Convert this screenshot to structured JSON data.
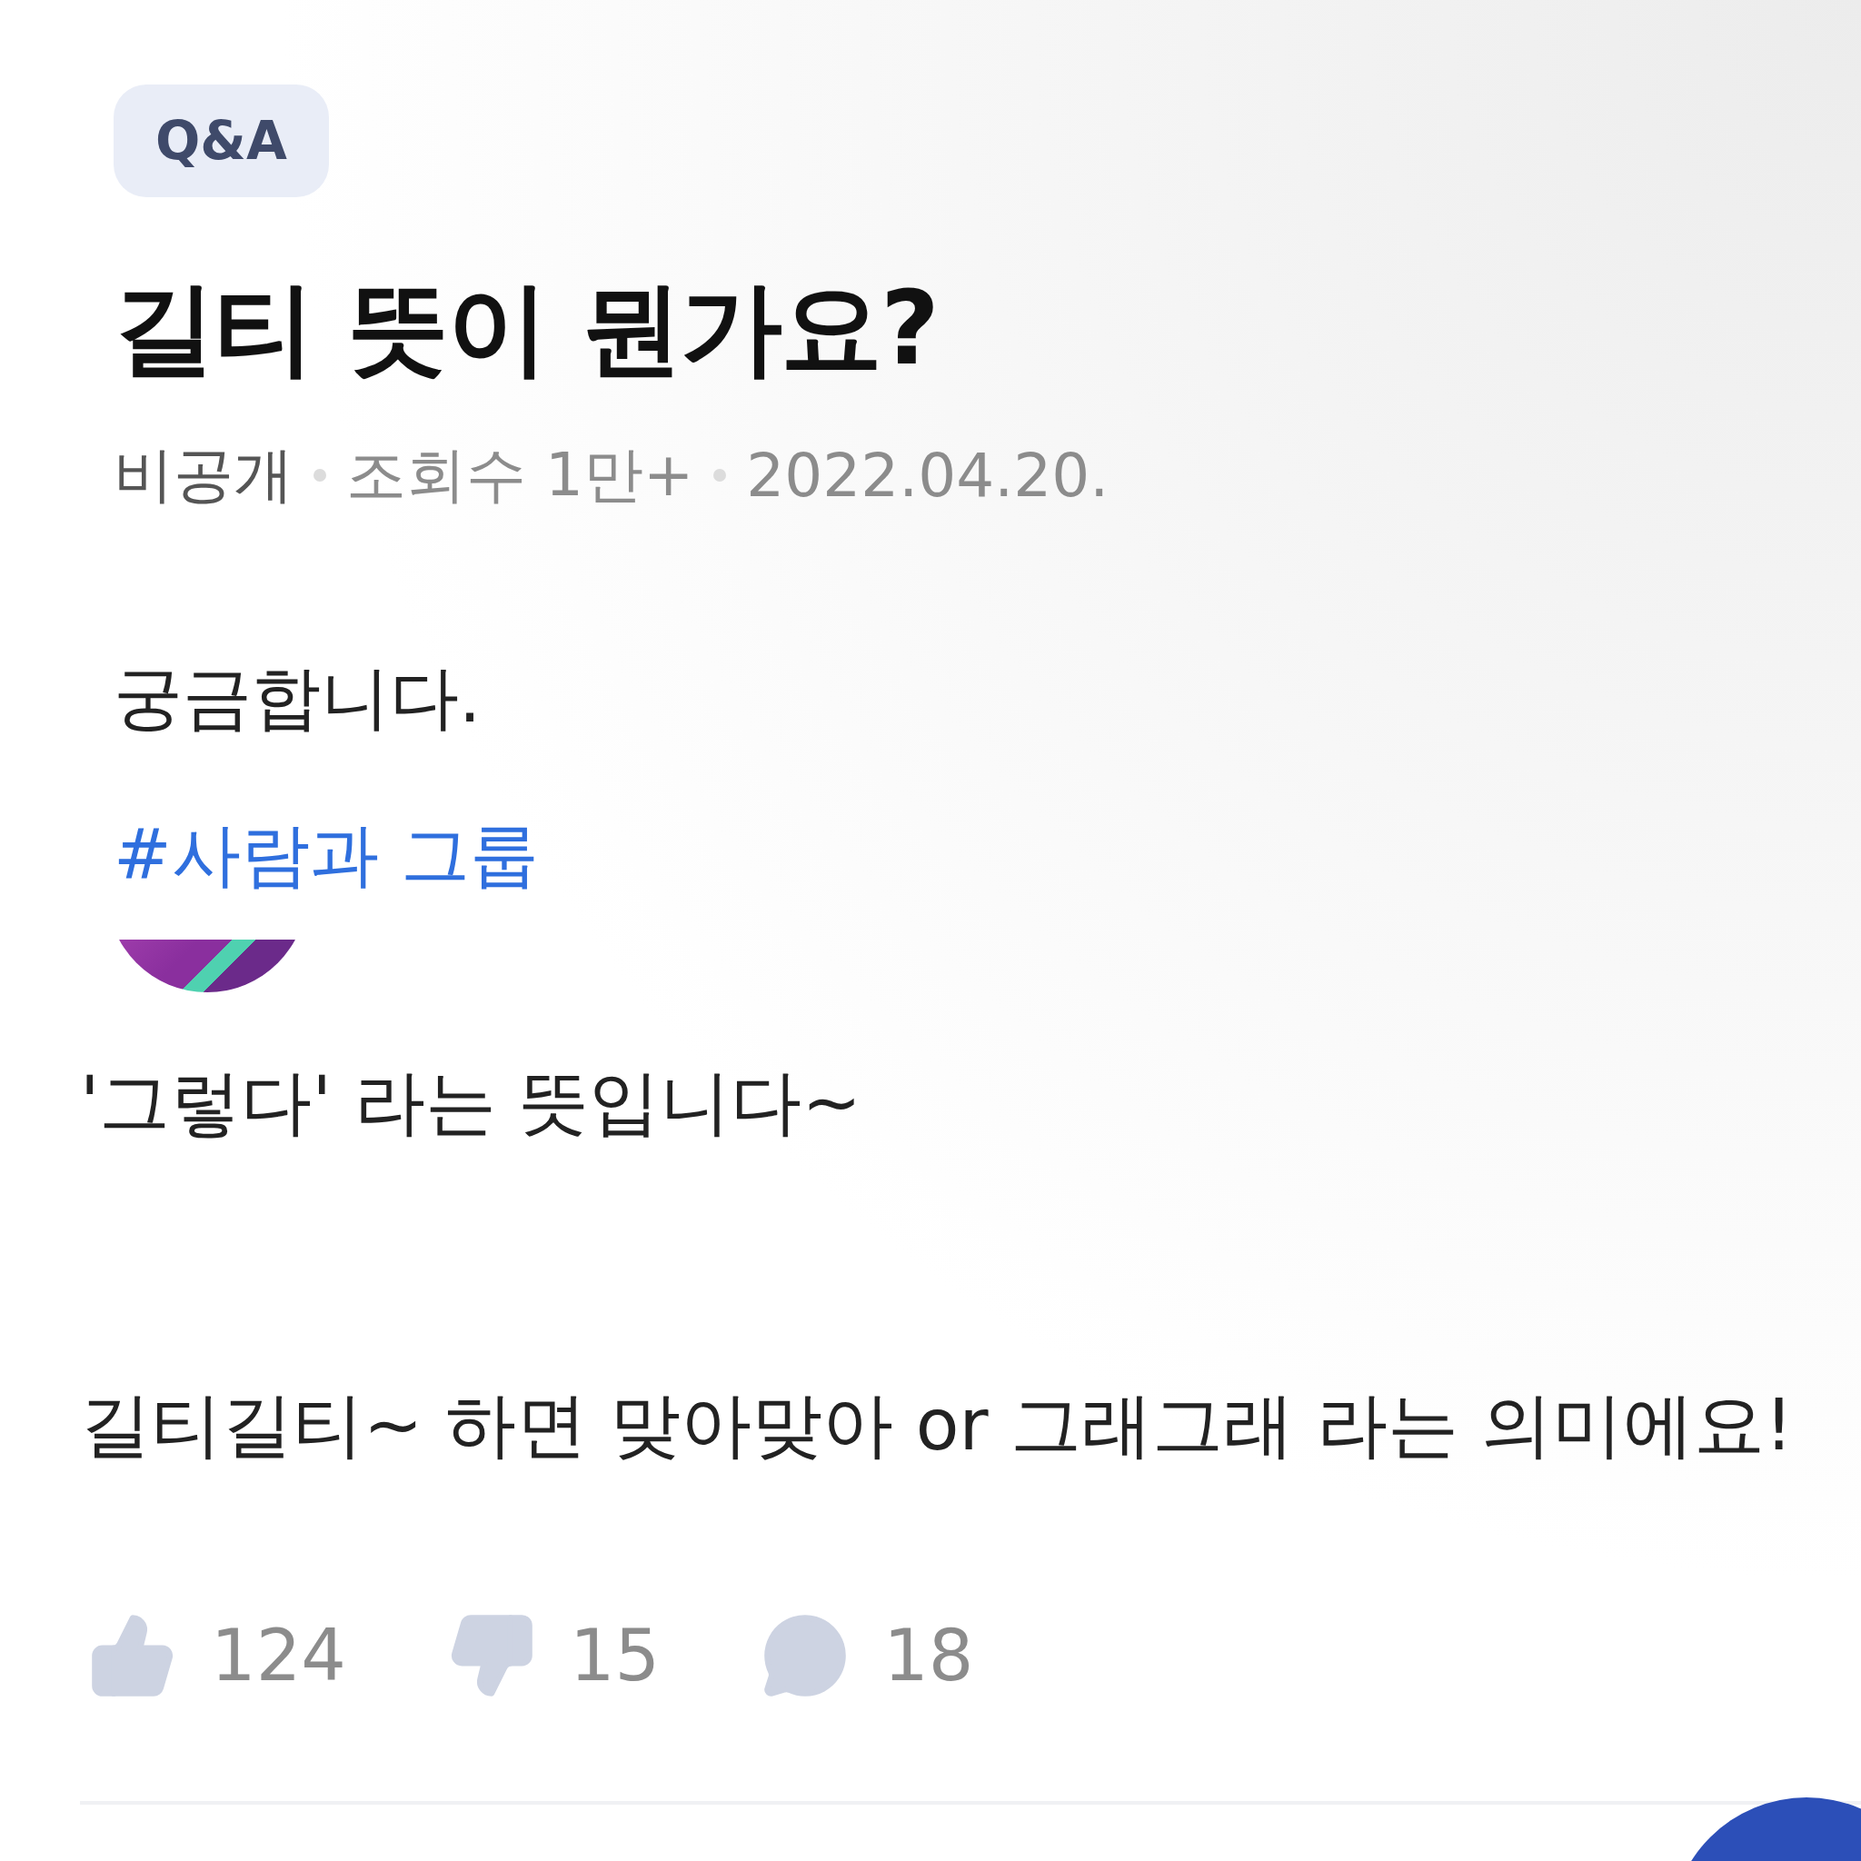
{
  "question": {
    "category": "Q&A",
    "title": "길티 뜻이 뭔가요?",
    "meta": [
      "비공개",
      "조회수 1만+",
      "2022.04.20."
    ],
    "body": "궁금합니다.",
    "tags": [
      "#사람과 그룹"
    ]
  },
  "answer": {
    "paragraphs": [
      "'그렇다' 라는 뜻입니다~",
      "길티길티~ 하면 맞아맞아 or 그래그래 라는 의미에요!"
    ],
    "reactions": [
      {
        "kind": "like",
        "count": "124"
      },
      {
        "kind": "dislike",
        "count": "15"
      },
      {
        "kind": "comment",
        "count": "18"
      }
    ]
  }
}
